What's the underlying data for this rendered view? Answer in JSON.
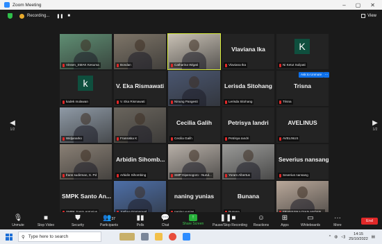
{
  "window": {
    "title": "Zoom Meeting",
    "controls": [
      "–",
      "▢",
      "✕"
    ]
  },
  "topbar": {
    "recording_label": "Recording...",
    "pause_glyph": "❚❚",
    "stop_glyph": "■",
    "view_label": "View"
  },
  "paging": {
    "left_arrow": "◀",
    "left_page": "1/2",
    "right_arrow": "▶",
    "right_page": "1/2"
  },
  "participants": [
    {
      "id": "p1",
      "label": "Vinsen_SMAK Kesuma",
      "display": "video",
      "bg": "#5f8e73"
    },
    {
      "id": "p2",
      "label": "Bondan",
      "display": "video",
      "bg": "#7e7568"
    },
    {
      "id": "p3",
      "label": "Catharina Wigati",
      "display": "video",
      "bg": "#c9c1b5",
      "active": true
    },
    {
      "id": "p4",
      "label": "Vlaviana Ika",
      "display": "name",
      "name": "Vlaviana Ika"
    },
    {
      "id": "p5",
      "label": "Ni Ketut Sulipati",
      "display": "avatar",
      "initial": "K"
    },
    {
      "id": "p6",
      "label": "kadek mulawan",
      "display": "avatar",
      "initial": "k"
    },
    {
      "id": "p7",
      "label": "V. Eka Rismawati",
      "display": "name",
      "name": "V. Eka Rismawati"
    },
    {
      "id": "p8",
      "label": "Ninung Pangesti",
      "display": "video",
      "bg": "#4a5670"
    },
    {
      "id": "p9",
      "label": "Lerisda Sitohang",
      "display": "name",
      "name": "Lerisda Sitohang"
    },
    {
      "id": "p10",
      "label": "Trisna",
      "display": "name",
      "name": "Trisna",
      "ask_label": "Ask to Unmute",
      "more": "..."
    },
    {
      "id": "p11",
      "label": "Widjanarko",
      "display": "video",
      "bg": "#8f9aa6"
    },
    {
      "id": "p12",
      "label": "Fransiska K",
      "display": "video",
      "bg": "#6a655d"
    },
    {
      "id": "p13",
      "label": "Cecilia Galih",
      "display": "name",
      "name": "Cecilia Galih"
    },
    {
      "id": "p14",
      "label": "Petrisya Iandri",
      "display": "name",
      "name": "Petrisya Iandri"
    },
    {
      "id": "p15",
      "label": "AVELINUS",
      "display": "name",
      "name": "AVELINUS"
    },
    {
      "id": "p16",
      "label": "frans sudirman, S. Pd",
      "display": "video",
      "bg": "#8a8075"
    },
    {
      "id": "p17",
      "label": "Arbidin Sihombing",
      "display": "name",
      "name": "Arbidin Sihomb..."
    },
    {
      "id": "p18",
      "label": "SMP Dipenogoro - Nurul...",
      "display": "video",
      "bg": "#b8b0a8"
    },
    {
      "id": "p19",
      "label": "Yoram Albertus",
      "display": "video",
      "bg": "#9a9a98"
    },
    {
      "id": "p20",
      "label": "Severius nansang",
      "display": "name",
      "name": "Severius nansang"
    },
    {
      "id": "p21",
      "label": "SMPK Santo Antonius",
      "display": "name",
      "name": "SMPK Santo An..."
    },
    {
      "id": "p22",
      "label": "Joshua Emmanuel",
      "display": "video",
      "bg": "#4d6fa8"
    },
    {
      "id": "p23",
      "label": "naning yunias",
      "display": "name",
      "name": "naning yunias"
    },
    {
      "id": "p24",
      "label": "Bunana",
      "display": "name",
      "name": "Bunana"
    },
    {
      "id": "p25",
      "label": "FRANSISKA DIAN ANDAN...",
      "display": "video",
      "bg": "#b9a89a"
    }
  ],
  "toolbar": {
    "unmute": "Unmute",
    "stop_video": "Stop Video",
    "security": "Security",
    "participants": "Participants",
    "participants_count": "37",
    "polls": "Polls",
    "chat": "Chat",
    "share_screen": "Share Screen",
    "pause_recording": "Pause/Stop Recording",
    "reactions": "Reactions",
    "apps": "Apps",
    "whiteboards": "Whiteboards",
    "more": "More",
    "end": "End"
  },
  "taskbar": {
    "search_placeholder": "Type here to search",
    "time": "14:15",
    "date": "25/10/2022"
  }
}
